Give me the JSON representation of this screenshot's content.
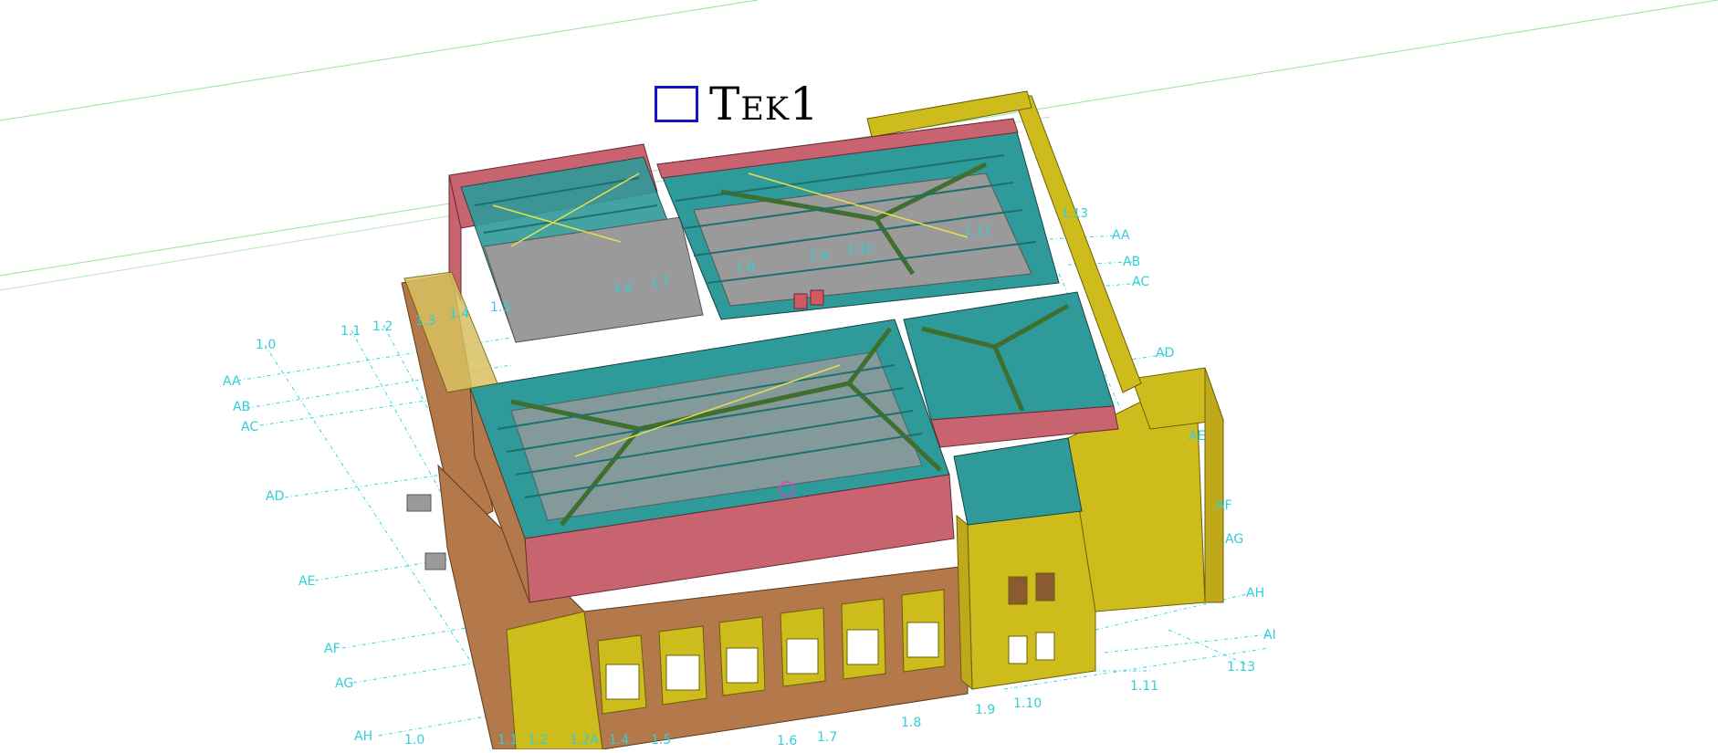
{
  "title": {
    "text": "Tek1",
    "box_color": "#1313c8"
  },
  "colors": {
    "background": "#ffffff",
    "grid": "#36d6dd",
    "horizon": "#8be08b",
    "wall_yellow": "#cdbc1c",
    "wall_brown": "#b3794a",
    "roof_pink": "#c76470",
    "truss_green": "#3f6f2e",
    "truss_teal": "#1f8c8c",
    "slab_grey": "#9a9a9a"
  },
  "left_grid": {
    "cols": [
      "1.0",
      "1.1",
      "1.2",
      "1.3",
      "1.4",
      "1.5"
    ],
    "rows": [
      "AA",
      "AB",
      "AC",
      "AD",
      "AE",
      "AF",
      "AG",
      "AH"
    ]
  },
  "right_grid": {
    "rows": [
      "AA",
      "AB",
      "AC",
      "AD",
      "AE",
      "AF",
      "AG",
      "AH",
      "AI"
    ],
    "cols": [
      "1.13",
      "1.11",
      "1.10",
      "1.9"
    ]
  },
  "bottom_grid": {
    "cols": [
      "1.0",
      "1.1",
      "1.2",
      "1.2A",
      "1.4",
      "1.5",
      "1.6",
      "1.7",
      "1.8"
    ]
  },
  "model_labels": {
    "inner_1": "1.6",
    "inner_2": "1.7",
    "inner_3": "1.8",
    "inner_4": "1.9",
    "inner_5": "1.10",
    "inner_6": "1.11",
    "inner_7": "1.13"
  }
}
